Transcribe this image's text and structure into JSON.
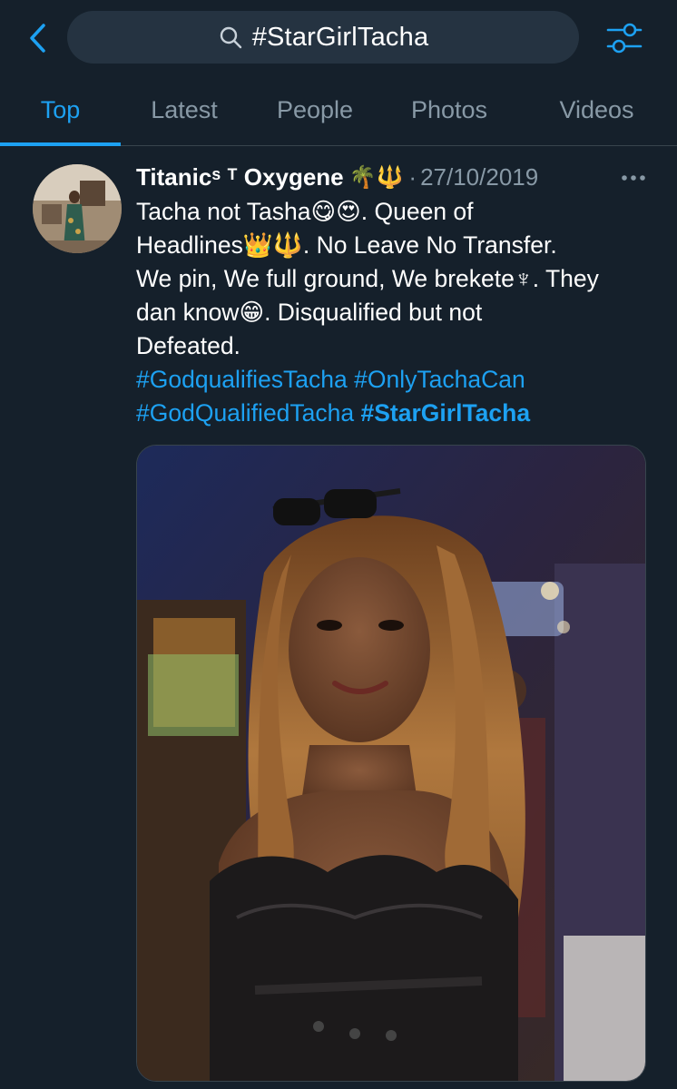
{
  "search": {
    "query": "#StarGirlTacha"
  },
  "tabs": [
    {
      "label": "Top",
      "active": true
    },
    {
      "label": "Latest",
      "active": false
    },
    {
      "label": "People",
      "active": false
    },
    {
      "label": "Photos",
      "active": false
    },
    {
      "label": "Videos",
      "active": false
    }
  ],
  "tweet": {
    "author": "Titanicˢ ᵀ Oxygene",
    "author_emoji": "🌴🔱",
    "separator": "·",
    "date": "27/10/2019",
    "lines": [
      "Tacha not Tasha😋😍. Queen of",
      "Headlines👑🔱. No Leave No Transfer.",
      "We pin, We full ground, We brekete♆. They",
      "dan know😁. Disqualified but not",
      "Defeated."
    ],
    "hashtags_line1": [
      "#GodqualifiesTacha",
      "#OnlyTachaCan"
    ],
    "hashtags_line2": [
      "#GodQualifiedTacha",
      "#StarGirlTacha"
    ]
  },
  "icons": {
    "back": "chevron-left-icon",
    "search": "search-icon",
    "filter": "sliders-icon",
    "more": "more-horizontal-icon"
  },
  "colors": {
    "background": "#15202b",
    "accent": "#1da1f2",
    "secondary_text": "#8899a6",
    "search_bg": "#253341",
    "divider": "#38444d"
  }
}
